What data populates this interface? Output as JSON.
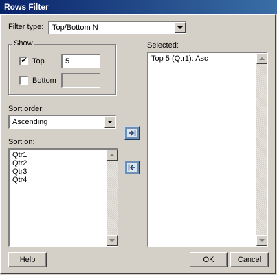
{
  "window": {
    "title": "Rows Filter"
  },
  "filter_type": {
    "label": "Filter type:",
    "value": "Top/Bottom N"
  },
  "show_group": {
    "title": "Show",
    "top": {
      "label": "Top",
      "checked": true,
      "value": "5"
    },
    "bottom": {
      "label": "Bottom",
      "checked": false,
      "value": ""
    }
  },
  "sort_order": {
    "label": "Sort order:",
    "value": "Ascending"
  },
  "sort_on": {
    "label": "Sort on:",
    "items": [
      "Qtr1",
      "Qtr2",
      "Qtr3",
      "Qtr4"
    ]
  },
  "selected": {
    "label": "Selected:",
    "items": [
      "Top 5 (Qtr1): Asc"
    ]
  },
  "buttons": {
    "help": "Help",
    "ok": "OK",
    "cancel": "Cancel"
  },
  "icons": {
    "add": "arrow-right-icon",
    "remove": "arrow-left-icon"
  }
}
